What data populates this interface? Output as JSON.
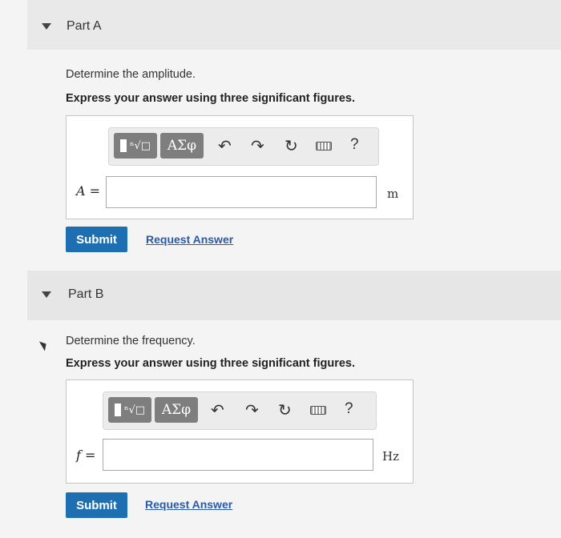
{
  "partA": {
    "title": "Part A",
    "question": "Determine the amplitude.",
    "instruction": "Express your answer using three significant figures.",
    "toolbar": {
      "greek_label": "ΑΣφ",
      "help_label": "?"
    },
    "variable": "A",
    "equals": "=",
    "input_value": "",
    "unit": "m",
    "submit_label": "Submit",
    "request_label": "Request Answer"
  },
  "partB": {
    "title": "Part B",
    "question": "Determine the frequency.",
    "instruction": "Express your answer using three significant figures.",
    "toolbar": {
      "greek_label": "ΑΣφ",
      "help_label": "?"
    },
    "variable": "f",
    "equals": "=",
    "input_value": "",
    "unit": "Hz",
    "submit_label": "Submit",
    "request_label": "Request Answer"
  },
  "colors": {
    "submit_bg": "#1e6fb1",
    "link": "#2a5aa8",
    "toolbar_button": "#7e7e7e"
  }
}
